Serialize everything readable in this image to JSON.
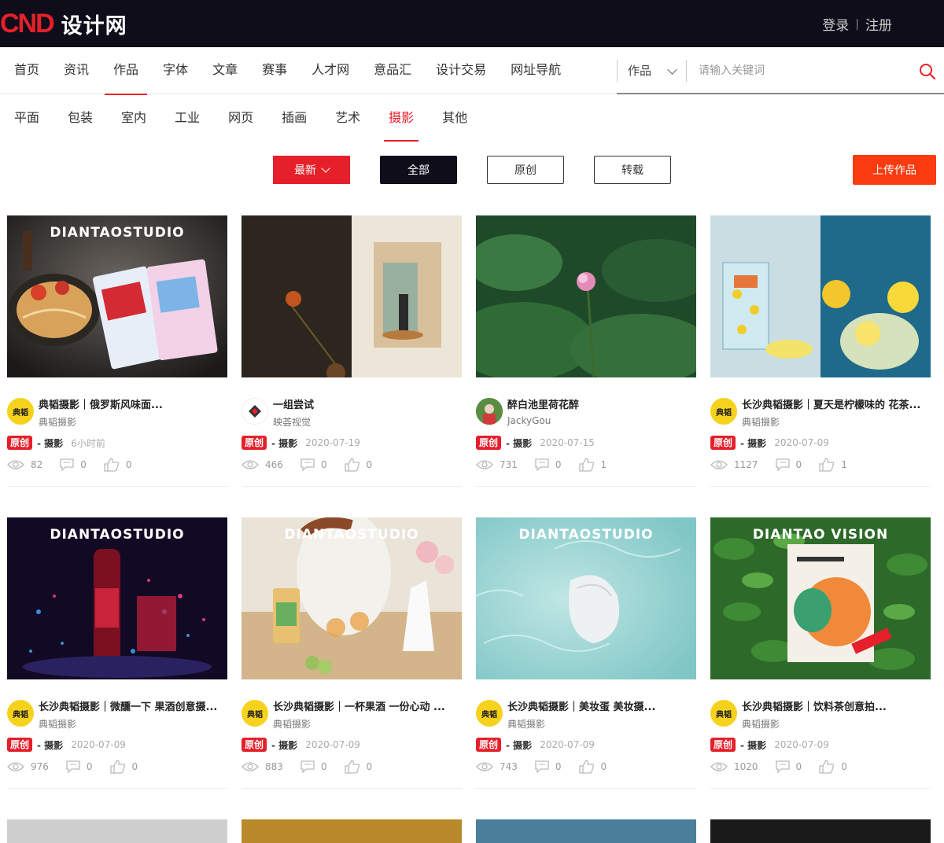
{
  "header": {
    "logo_mark": "CND",
    "logo_text": "设计网",
    "login": "登录",
    "auth_sep": "|",
    "register": "注册"
  },
  "mainnav": {
    "items": [
      "首页",
      "资讯",
      "作品",
      "字体",
      "文章",
      "赛事",
      "人才网",
      "意品汇",
      "设计交易",
      "网址导航"
    ],
    "active_index": 2
  },
  "search": {
    "scope": "作品",
    "placeholder": "请输入关键词",
    "icon": "search-icon"
  },
  "subnav": {
    "items": [
      "平面",
      "包装",
      "室内",
      "工业",
      "网页",
      "插画",
      "艺术",
      "摄影",
      "其他"
    ],
    "active_index": 7
  },
  "filters": {
    "sort": "最新",
    "all": "全部",
    "original": "原创",
    "repost": "转载",
    "upload": "上传作品"
  },
  "colors": {
    "brand_red": "#e5202a",
    "upload_orange": "#fa3b10",
    "topbar": "#0f0d1a"
  },
  "cards": [
    {
      "title": "典韬摄影｜俄罗斯风味面...",
      "author": "典韬摄影",
      "tag": "原创",
      "category": "- 摄影",
      "date": "6小时前",
      "views": "82",
      "comments": "0",
      "likes": "0",
      "watermark": "DIANTAOSTUDIO",
      "avatar": "典韬"
    },
    {
      "title": "一组尝试",
      "author": "映荟视觉",
      "tag": "原创",
      "category": "- 摄影",
      "date": "2020-07-19",
      "views": "466",
      "comments": "0",
      "likes": "0",
      "watermark": "",
      "avatar": ""
    },
    {
      "title": "醉白池里荷花醉",
      "author": "JackyGou",
      "tag": "原创",
      "category": "- 摄影",
      "date": "2020-07-15",
      "views": "731",
      "comments": "0",
      "likes": "1",
      "watermark": "",
      "avatar": ""
    },
    {
      "title": "长沙典韬摄影｜夏天是柠檬味的 花茶...",
      "author": "典韬摄影",
      "tag": "原创",
      "category": "- 摄影",
      "date": "2020-07-09",
      "views": "1127",
      "comments": "0",
      "likes": "1",
      "watermark": "",
      "avatar": "典韬"
    },
    {
      "title": "长沙典韬摄影｜微醺一下 果酒创意摄...",
      "author": "典韬摄影",
      "tag": "原创",
      "category": "- 摄影",
      "date": "2020-07-09",
      "views": "976",
      "comments": "0",
      "likes": "0",
      "watermark": "DIANTAOSTUDIO",
      "avatar": "典韬"
    },
    {
      "title": "长沙典韬摄影｜一杯果酒 一份心动 ...",
      "author": "典韬摄影",
      "tag": "原创",
      "category": "- 摄影",
      "date": "2020-07-09",
      "views": "883",
      "comments": "0",
      "likes": "0",
      "watermark": "DIANTAOSTUDIO",
      "avatar": "典韬"
    },
    {
      "title": "长沙典韬摄影｜美妆蛋 美妆摄...",
      "author": "典韬摄影",
      "tag": "原创",
      "category": "- 摄影",
      "date": "2020-07-09",
      "views": "743",
      "comments": "0",
      "likes": "0",
      "watermark": "DIANTAOSTUDIO",
      "avatar": "典韬"
    },
    {
      "title": "长沙典韬摄影｜饮料茶创意拍...",
      "author": "典韬摄影",
      "tag": "原创",
      "category": "- 摄影",
      "date": "2020-07-09",
      "views": "1020",
      "comments": "0",
      "likes": "0",
      "watermark": "DIANTAO VISION",
      "avatar": "典韬"
    }
  ]
}
